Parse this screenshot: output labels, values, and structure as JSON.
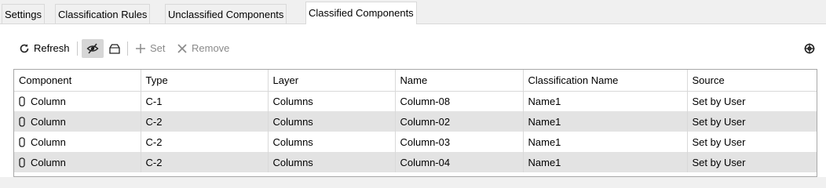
{
  "tabs": [
    {
      "label": "Settings",
      "active": false
    },
    {
      "label": "Classification Rules",
      "active": false
    },
    {
      "label": "Unclassified Components",
      "active": false
    },
    {
      "label": "Classified Components",
      "active": true
    }
  ],
  "toolbar": {
    "refresh_label": "Refresh",
    "set_label": "Set",
    "remove_label": "Remove",
    "icons": [
      "refresh-icon",
      "hide-icon",
      "component-icon",
      "plus-icon",
      "x-icon",
      "settings-icon"
    ]
  },
  "table": {
    "columns": [
      "Component",
      "Type",
      "Layer",
      "Name",
      "Classification Name",
      "Source"
    ],
    "rows": [
      {
        "component": "Column",
        "type": "C-1",
        "layer": "Columns",
        "name": "Column-08",
        "classification": "Name1",
        "source": "Set by User"
      },
      {
        "component": "Column",
        "type": "C-2",
        "layer": "Columns",
        "name": "Column-02",
        "classification": "Name1",
        "source": "Set by User"
      },
      {
        "component": "Column",
        "type": "C-2",
        "layer": "Columns",
        "name": "Column-03",
        "classification": "Name1",
        "source": "Set by User"
      },
      {
        "component": "Column",
        "type": "C-2",
        "layer": "Columns",
        "name": "Column-04",
        "classification": "Name1",
        "source": "Set by User"
      }
    ]
  },
  "colors": {
    "accent_bar": "#d6d6d6",
    "row_alt": "#e3e3e3",
    "disabled_text": "#8a8a8a"
  }
}
